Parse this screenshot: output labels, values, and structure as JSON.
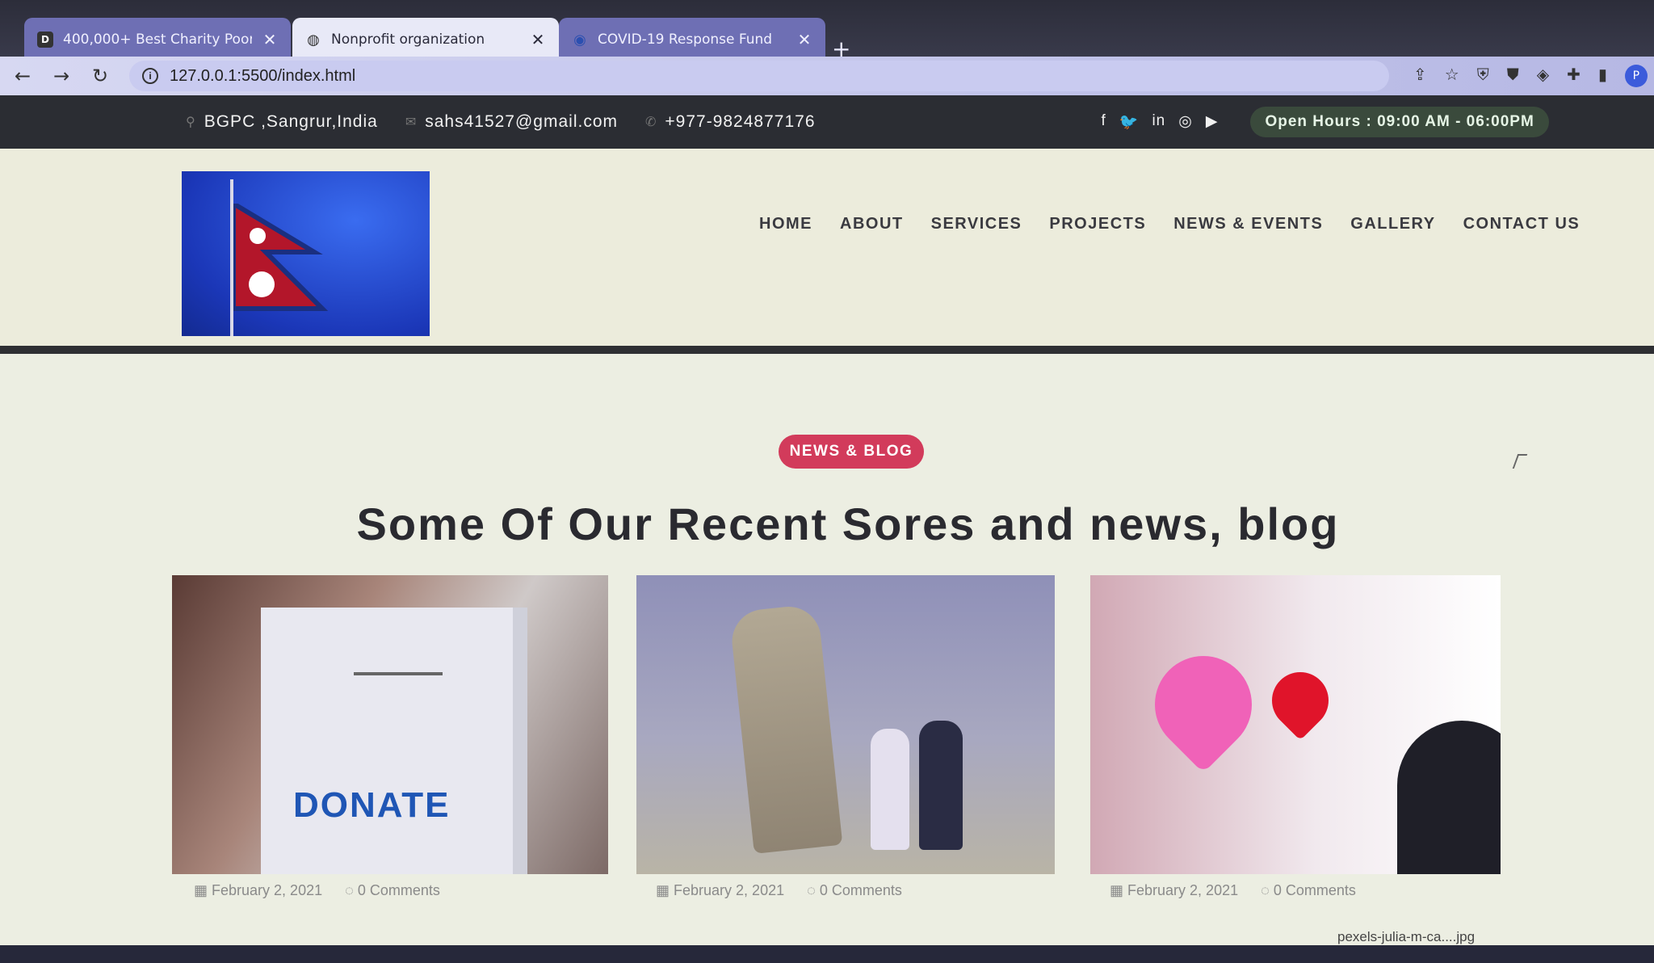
{
  "browser": {
    "tabs": [
      {
        "title": "400,000+ Best Charity Poor Peop",
        "favicon": "D",
        "state": "inactive"
      },
      {
        "title": "Nonprofit organization",
        "favicon": "globe",
        "state": "active"
      },
      {
        "title": "COVID-19 Response Fund",
        "favicon": "un",
        "state": "inactive"
      }
    ],
    "new_tab_icon": "+",
    "url": "127.0.0.1:5500/index.html",
    "profile_initial": "P"
  },
  "site": {
    "topbar": {
      "location": "BGPC ,Sangrur,India",
      "email": "sahs41527@gmail.com",
      "phone": "+977-9824877176",
      "social": [
        "f",
        "t",
        "in",
        "ig",
        "yt"
      ],
      "hours": "Open Hours : 09:00 AM - 06:00PM"
    },
    "nav": [
      "HOME",
      "ABOUT",
      "SERVICES",
      "PROJECTS",
      "NEWS & EVENTS",
      "GALLERY",
      "CONTACT US"
    ],
    "blog": {
      "badge": "NEWS & BLOG",
      "heading": "Some Of Our Recent Sores and news, blog",
      "cards": [
        {
          "image_text": "DONATE",
          "date": "February 2, 2021",
          "comments": "0 Comments"
        },
        {
          "date": "February 2, 2021",
          "comments": "0 Comments"
        },
        {
          "date": "February 2, 2021",
          "comments": "0 Comments"
        }
      ]
    }
  },
  "downloads": {
    "file": "pexels-julia-m-ca....jpg"
  },
  "colors": {
    "accent": "#d23b5b",
    "topbar": "#2b2d33",
    "hours_bg": "#3a4a3c"
  }
}
